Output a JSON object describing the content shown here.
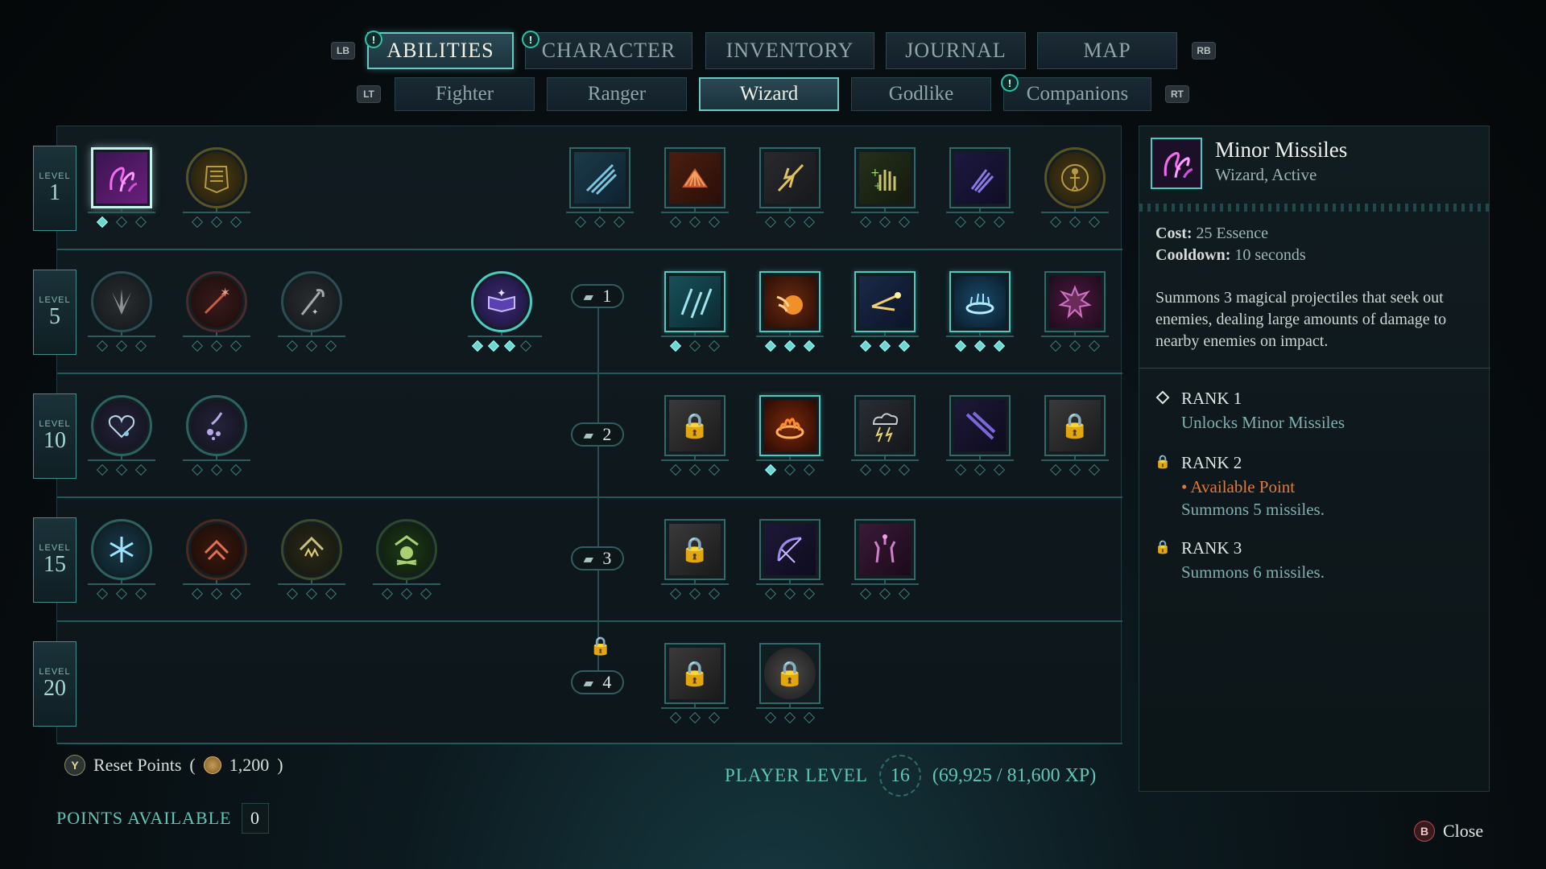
{
  "top_tabs": {
    "left_bumper": "LB",
    "right_bumper": "RB",
    "tabs": [
      {
        "label": "ABILITIES",
        "active": true,
        "alert": "!"
      },
      {
        "label": "CHARACTER",
        "active": false,
        "alert": "!"
      },
      {
        "label": "INVENTORY",
        "active": false,
        "alert": ""
      },
      {
        "label": "JOURNAL",
        "active": false,
        "alert": ""
      },
      {
        "label": "MAP",
        "active": false,
        "alert": ""
      }
    ]
  },
  "sub_tabs": {
    "left_trigger": "LT",
    "right_trigger": "RT",
    "tabs": [
      {
        "label": "Fighter",
        "active": false,
        "alert": ""
      },
      {
        "label": "Ranger",
        "active": false,
        "alert": ""
      },
      {
        "label": "Wizard",
        "active": true,
        "alert": ""
      },
      {
        "label": "Godlike",
        "active": false,
        "alert": ""
      },
      {
        "label": "Companions",
        "active": false,
        "alert": "!"
      }
    ]
  },
  "levels": [
    {
      "label": "LEVEL",
      "value": "1"
    },
    {
      "label": "LEVEL",
      "value": "5"
    },
    {
      "label": "LEVEL",
      "value": "10"
    },
    {
      "label": "LEVEL",
      "value": "15"
    },
    {
      "label": "LEVEL",
      "value": "20"
    }
  ],
  "tier_nodes": [
    {
      "value": "1",
      "locked": false
    },
    {
      "value": "2",
      "locked": false
    },
    {
      "value": "3",
      "locked": false
    },
    {
      "value": "4",
      "locked": true
    }
  ],
  "colors": {
    "accent": "#6fc7c4",
    "teal_text": "#5fc7b7",
    "orange": "#e0793a",
    "lock": "#e67e22"
  },
  "footer": {
    "reset_button": "Y",
    "reset_label": "Reset Points",
    "reset_cost": "1,200",
    "player_level_label": "PLAYER LEVEL",
    "player_level": "16",
    "xp": "(69,925 / 81,600 XP)",
    "points_available_label": "POINTS AVAILABLE",
    "points_available": "0"
  },
  "detail": {
    "title": "Minor Missiles",
    "subtitle": "Wizard, Active",
    "cost_label": "Cost:",
    "cost_value": "25 Essence",
    "cooldown_label": "Cooldown:",
    "cooldown_value": "10 seconds",
    "description": "Summons 3 magical projectiles that seek out enemies, dealing large amounts of damage to nearby enemies on impact.",
    "ranks": [
      {
        "title": "RANK 1",
        "icon": "diamond-icon",
        "lines": [
          {
            "text": "Unlocks Minor Missiles",
            "style": "teal"
          }
        ]
      },
      {
        "title": "RANK 2",
        "icon": "lock-icon",
        "lines": [
          {
            "text": "• Available Point",
            "style": "orange"
          },
          {
            "text": "Summons 5 missiles.",
            "style": "teal"
          }
        ]
      },
      {
        "title": "RANK 3",
        "icon": "lock-icon",
        "lines": [
          {
            "text": "Summons 6 missiles.",
            "style": "teal"
          }
        ]
      }
    ]
  },
  "close": {
    "button": "B",
    "label": "Close"
  }
}
